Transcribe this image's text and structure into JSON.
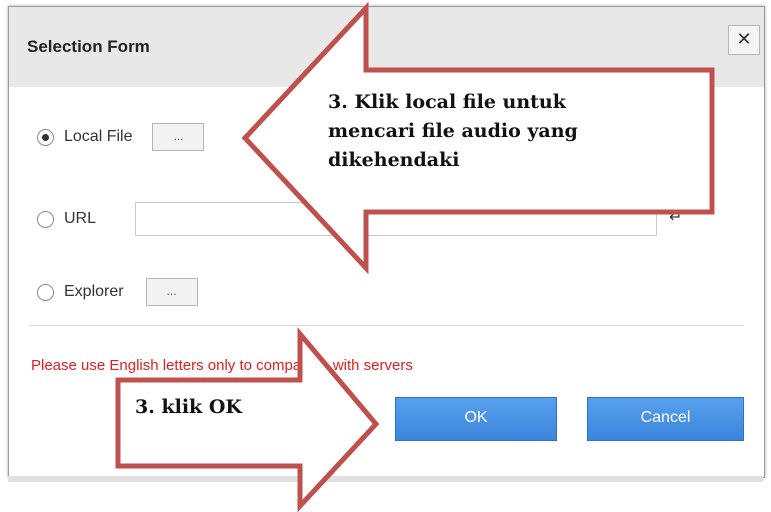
{
  "dialog": {
    "title": "Selection Form",
    "close_label": "✕"
  },
  "options": {
    "local_file": {
      "label": "Local File",
      "browse_label": "...",
      "selected": true
    },
    "url": {
      "label": "URL",
      "value": "",
      "enter_icon": "↵",
      "selected": false
    },
    "explorer": {
      "label": "Explorer",
      "browse_label": "...",
      "selected": false
    }
  },
  "warning": "Please use English letters only to compatible with servers",
  "buttons": {
    "ok_label": "OK",
    "cancel_label": "Cancel"
  },
  "annotations": {
    "top_callout": "3. Klik local file untuk mencari file audio yang dikehendaki",
    "bottom_callout": "3. klik OK"
  },
  "colors": {
    "arrow_fill": "#ffffff",
    "arrow_stroke": "#c0504d",
    "button": "#3b85dc",
    "warning": "#e02020"
  }
}
